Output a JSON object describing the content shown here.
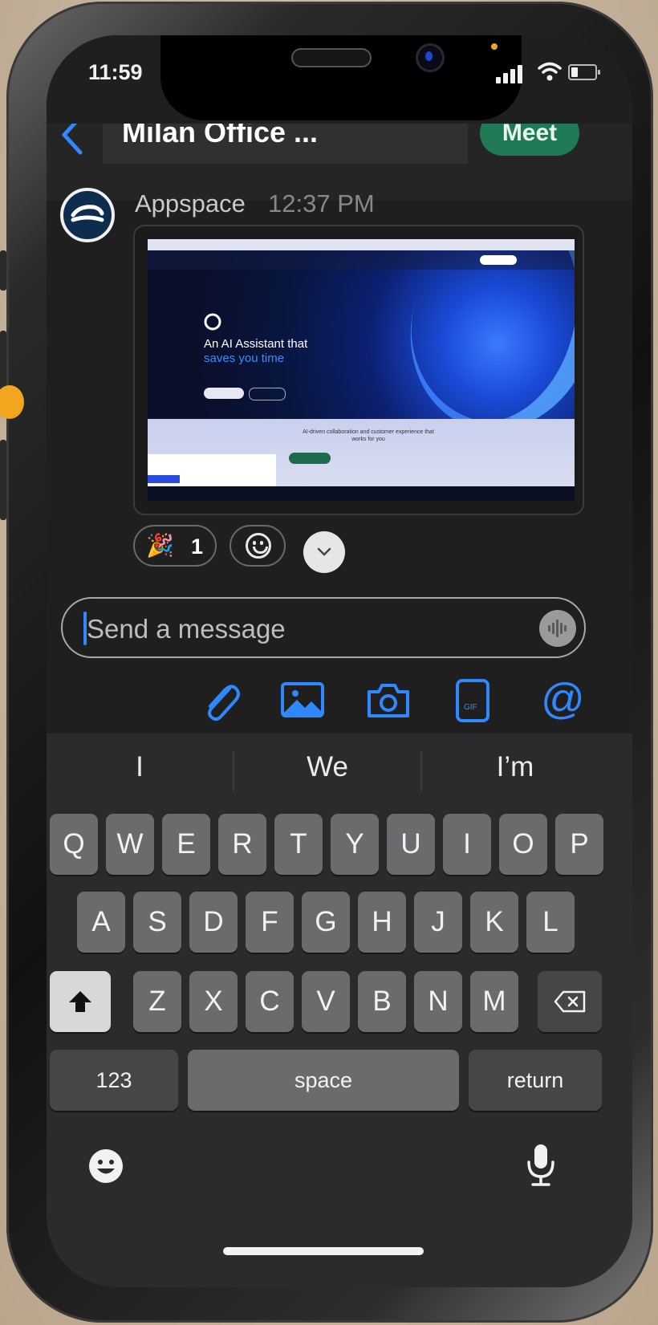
{
  "status_bar": {
    "time": "11:59"
  },
  "header": {
    "back_icon": "chevron-left-icon",
    "title": "Milan Office ...",
    "meet_label": "Meet"
  },
  "message": {
    "sender": "Appspace",
    "time": "12:37 PM",
    "avatar_icon": "appspace-logo-icon",
    "preview": {
      "headline_line1": "An AI Assistant that",
      "headline_line2": "saves you time",
      "subtext": "AI-driven collaboration and customer experience that works for you"
    }
  },
  "reactions": [
    {
      "emoji": "🎉",
      "count": "1"
    }
  ],
  "composer": {
    "placeholder": "Send a message"
  },
  "toolbar": {
    "icons": [
      "paperclip-icon",
      "image-icon",
      "camera-icon",
      "gif-icon",
      "mention-icon"
    ],
    "gif_label": "GIF",
    "mention_label": "@"
  },
  "keyboard": {
    "suggestions": [
      "I",
      "We",
      "I’m"
    ],
    "row1": [
      "Q",
      "W",
      "E",
      "R",
      "T",
      "Y",
      "U",
      "I",
      "O",
      "P"
    ],
    "row2": [
      "A",
      "S",
      "D",
      "F",
      "G",
      "H",
      "J",
      "K",
      "L"
    ],
    "row3": [
      "Z",
      "X",
      "C",
      "V",
      "B",
      "N",
      "M"
    ],
    "numbers_label": "123",
    "space_label": "space",
    "return_label": "return"
  },
  "colors": {
    "accent": "#2f88ff",
    "meet_green": "#1f7a55",
    "background": "#1f1f20"
  }
}
